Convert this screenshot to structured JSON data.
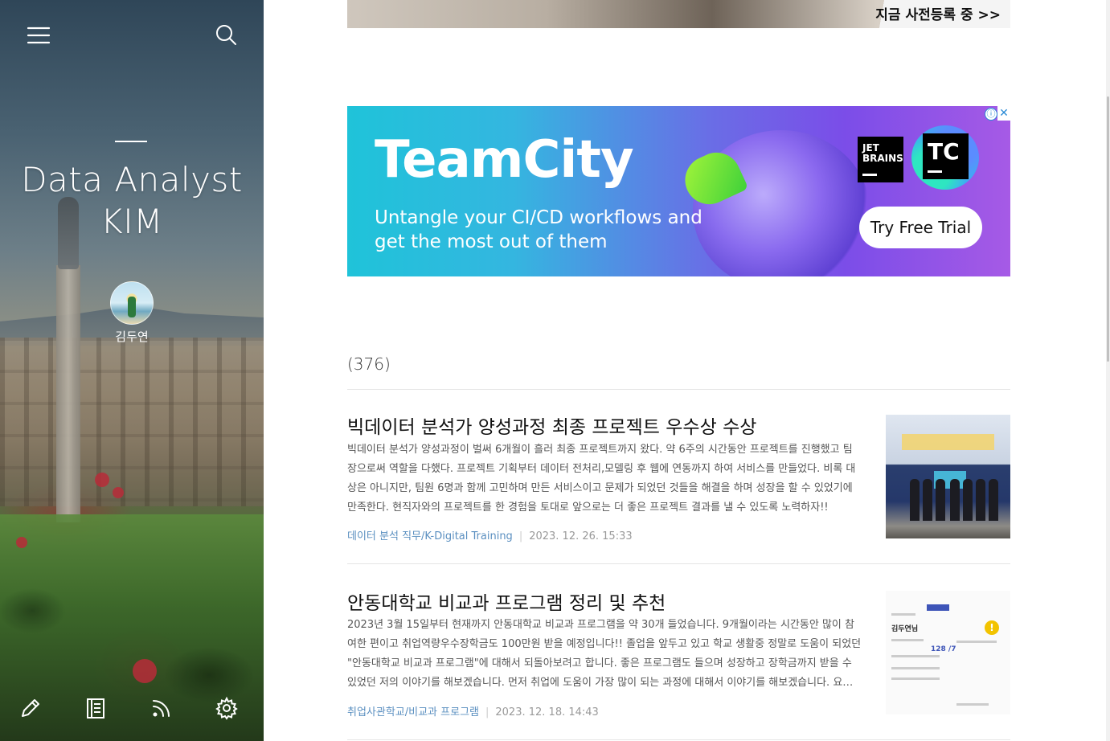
{
  "sidebar": {
    "blog_title": "Data Analyst KIM",
    "author_name": "김두연",
    "icons": {
      "menu": "hamburger-menu-icon",
      "search": "search-icon",
      "write": "pencil-icon",
      "guestbook": "notebook-icon",
      "rss": "rss-icon",
      "settings": "gear-icon"
    }
  },
  "top_banner": {
    "cta_text": "지금 사전등록 중 >>"
  },
  "ad": {
    "brand": "TeamCity",
    "tagline": "Untangle your CI/CD workflows and get the most out of them",
    "cta": "Try Free Trial",
    "jetbrains_logo": "JET BRAINS",
    "product_logo": "TC",
    "info_icon": "ⓘ",
    "close_icon": "✕"
  },
  "post_list": {
    "count": "(376)",
    "posts": [
      {
        "title": "빅데이터 분석가 양성과정 최종 프로젝트 우수상 수상",
        "excerpt": "빅데이터 분석가 양성과정이 벌써 6개월이 흘러 최종 프로젝트까지 왔다. 약 6주의 시간동안 프로젝트를 진행했고 팀장으로써 역할을 다했다. 프로젝트 기획부터 데이터 전처리,모델링 후 웹에 연동까지 하여 서비스를 만들었다. 비록 대상은 아니지만, 팀원 6명과 함께 고민하며 만든 서비스이고 문제가 되었던 것들을 해결을 하며 성장을 할 수 있었기에 만족한다. 현직자와의 프로젝트를 한 경험을 토대로 앞으로는 더 좋은 프로젝트 결과를 낼 수 있도록 노력하자!!",
        "category": "데이터 분석 직무/K-Digital Training",
        "date": "2023. 12. 26. 15:33"
      },
      {
        "title": "안동대학교 비교과 프로그램 정리 및 추천",
        "excerpt": "2023년 3월 15일부터 현재까지 안동대학교 비교과 프로그램을 약 30개 들었습니다. 9개월이라는 시간동안 많이 참여한 편이고 취업역량우수장학금도 100만원 받을 예정입니다!! 졸업을 앞두고 있고 학교 생활중 정말로 도움이 되었던 \"안동대학교 비교과 프로그램\"에 대해서 되돌아보려고 합니다. 좋은 프로그램도 들으며 성장하고 장학금까지 받을 수 있었던 저의 이야기를 해보겠습니다. 먼저 취업에 도움이 가장 많이 되는 과정에 대해서 이야기를 해보겠습니다. 요…",
        "category": "취업사관학교/비교과 프로그램",
        "date": "2023. 12. 18. 14:43"
      }
    ]
  },
  "thumb2": {
    "name": "김두연님",
    "score": "128 /7"
  }
}
